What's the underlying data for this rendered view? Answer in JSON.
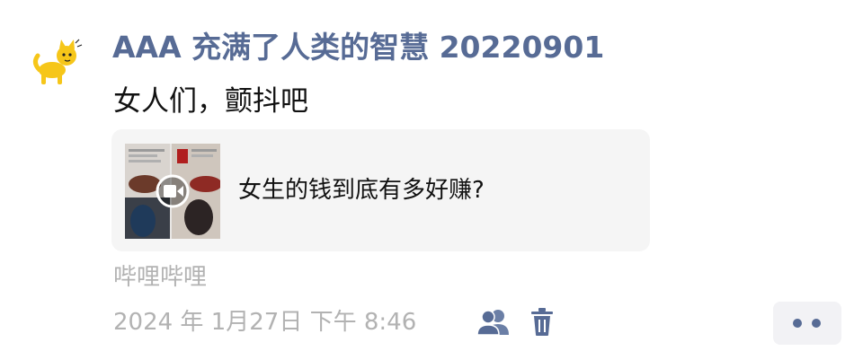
{
  "post": {
    "author": "AAA 充满了人类的智慧 20220901",
    "text": "女人们，颤抖吧"
  },
  "link_card": {
    "title": "女生的钱到底有多好赚?",
    "thumbnail_icon": "video-play-icon"
  },
  "meta": {
    "source": "哔哩哔哩",
    "timestamp": "2024 年 1月27日 下午 8:46"
  },
  "icons": {
    "avatar": "yellow-cat-avatar",
    "friends": "friends-visibility-icon",
    "delete": "trash-icon",
    "more": "more-dots-icon"
  },
  "colors": {
    "name": "#576b95",
    "secondary_text": "#b2b2b2",
    "card_bg": "#f5f5f5",
    "more_bg": "#f2f2f5"
  }
}
